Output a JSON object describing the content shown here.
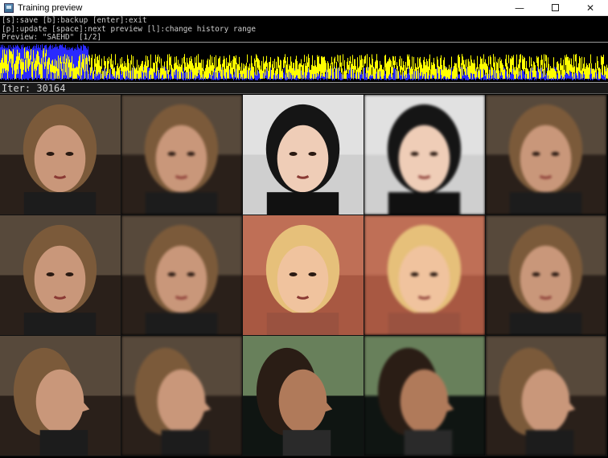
{
  "window": {
    "title": "Training preview",
    "controls": {
      "minimize": "—",
      "close": "✕"
    }
  },
  "console": {
    "lines": [
      "[s]:save [b]:backup [enter]:exit",
      "[p]:update [space]:next preview [l]:change history range",
      "Preview: \"SAEHD\" [1/2]"
    ]
  },
  "status": {
    "iter_label": "Iter: 30164"
  },
  "colors": {
    "loss_src": "#ffff00",
    "loss_dst": "#2a2aff",
    "background": "#000000"
  },
  "preview_grid": {
    "rows": [
      {
        "cells": [
          {
            "kind": "src",
            "face": "older man, long brown hair"
          },
          {
            "kind": "src-predicted",
            "face": "older man, long brown hair"
          },
          {
            "kind": "dst",
            "face": "young woman, dark hair"
          },
          {
            "kind": "dst-predicted",
            "face": "young woman, dark hair"
          },
          {
            "kind": "swap",
            "face": "older man on woman"
          }
        ]
      },
      {
        "cells": [
          {
            "kind": "src",
            "face": "older man looking down"
          },
          {
            "kind": "src-predicted",
            "face": "older man looking down"
          },
          {
            "kind": "dst",
            "face": "blonde woman smiling"
          },
          {
            "kind": "dst-predicted",
            "face": "blonde woman smiling"
          },
          {
            "kind": "swap",
            "face": "older man on blonde woman"
          }
        ]
      },
      {
        "cells": [
          {
            "kind": "src",
            "face": "older man profile"
          },
          {
            "kind": "src-predicted",
            "face": "older man profile"
          },
          {
            "kind": "dst",
            "face": "man profile, short hair"
          },
          {
            "kind": "dst-predicted",
            "face": "man profile, short hair"
          },
          {
            "kind": "swap",
            "face": "older man profile swap"
          }
        ]
      }
    ]
  }
}
